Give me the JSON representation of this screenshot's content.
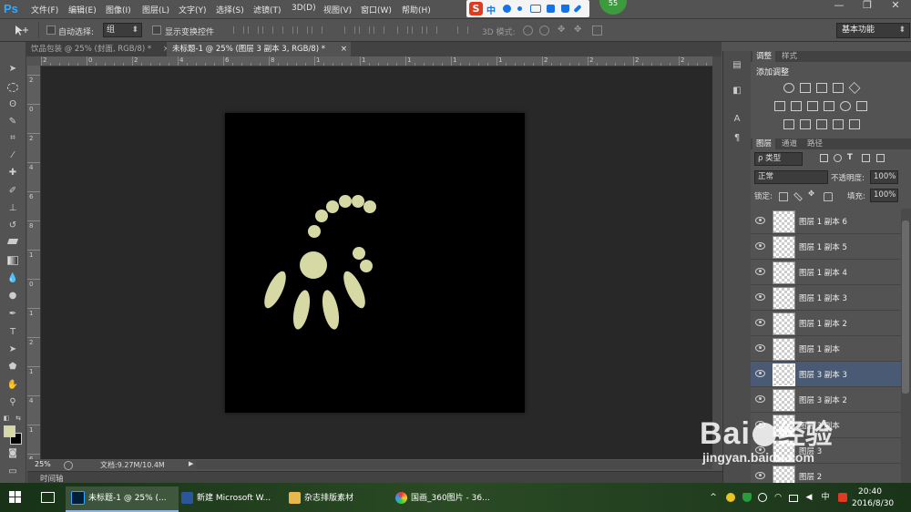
{
  "app": {
    "logo": "Ps"
  },
  "menu": [
    "文件(F)",
    "编辑(E)",
    "图像(I)",
    "图层(L)",
    "文字(Y)",
    "选择(S)",
    "滤镜(T)",
    "3D(D)",
    "视图(V)",
    "窗口(W)",
    "帮助(H)"
  ],
  "ime": {
    "logo": "S",
    "mode": "中",
    "icons": [
      "moon-icon",
      "dot-icon",
      "keyboard-icon",
      "grid-icon",
      "shirt-icon",
      "wrench-icon"
    ]
  },
  "badge": "55",
  "window_controls": {
    "minimize": "—",
    "restore": "❐",
    "close": "✕"
  },
  "options": {
    "auto_select_label": "自动选择:",
    "auto_select_value": "组",
    "transform_label": "显示变换控件",
    "mode3d_label": "3D 模式:",
    "workspace": "基本功能"
  },
  "tabs": [
    {
      "title": "饮品包装 @ 25% (封面, RGB/8) *",
      "close": "×"
    },
    {
      "title": "未标题-1 @ 25% (图层 3 副本 3, RGB/8) *",
      "close": "×"
    }
  ],
  "ruler": {
    "h_labels": [
      "2",
      "0",
      "2",
      "4",
      "6",
      "8",
      "1",
      "1",
      "1",
      "1",
      "1",
      "2",
      "2",
      "2",
      "2"
    ],
    "v_labels": [
      "2",
      "0",
      "2",
      "4",
      "6",
      "8",
      "1",
      "0",
      "1",
      "2",
      "1",
      "4",
      "1",
      "6"
    ]
  },
  "canvas": {
    "artwork_color": "#d7d9a4",
    "background": "#000000"
  },
  "status": {
    "zoom": "25%",
    "doc": "文档:9.27M/10.4M",
    "arrow": "▶"
  },
  "timeline": {
    "label": "时间轴"
  },
  "colors": {
    "foreground": "#d7d9a4",
    "background": "#000000",
    "selection": "#4a5a74"
  },
  "panels": {
    "adjust_tabs": [
      "调整",
      "样式"
    ],
    "adjust_title": "添加调整",
    "layers_tabs": [
      "图层",
      "通道",
      "路径"
    ],
    "filter_kind": "ρ 类型",
    "blend_mode": "正常",
    "opacity_label": "不透明度:",
    "opacity_value": "100%",
    "lock_label": "锁定:",
    "fill_label": "填充:",
    "fill_value": "100%",
    "layers": [
      {
        "name": "图层 1 副本 6",
        "selected": false
      },
      {
        "name": "图层 1 副本 5",
        "selected": false
      },
      {
        "name": "图层 1 副本 4",
        "selected": false
      },
      {
        "name": "图层 1 副本 3",
        "selected": false
      },
      {
        "name": "图层 1 副本 2",
        "selected": false
      },
      {
        "name": "图层 1 副本",
        "selected": false
      },
      {
        "name": "图层 3 副本 3",
        "selected": true
      },
      {
        "name": "图层 3 副本 2",
        "selected": false
      },
      {
        "name": "图层 3 副本",
        "selected": false
      },
      {
        "name": "图层 3",
        "selected": false
      },
      {
        "name": "图层 2",
        "selected": false
      }
    ]
  },
  "taskbar": {
    "items": [
      {
        "label": "未标题-1 @ 25% (...",
        "icon": "photoshop-icon",
        "color": "#001e36"
      },
      {
        "label": "新建 Microsoft W...",
        "icon": "word-icon",
        "color": "#2b579a"
      },
      {
        "label": "杂志排版素材",
        "icon": "folder-icon",
        "color": "#e8b84a"
      },
      {
        "label": "国画_360图片 - 36...",
        "icon": "browser-icon",
        "color": "#3aa0e0"
      }
    ],
    "tray_ime": "中",
    "time": "20:40",
    "date": "2016/8/30"
  },
  "watermark": {
    "brand": "Bai",
    "brand2": "经验",
    "url": "jingyan.baidu.com"
  }
}
